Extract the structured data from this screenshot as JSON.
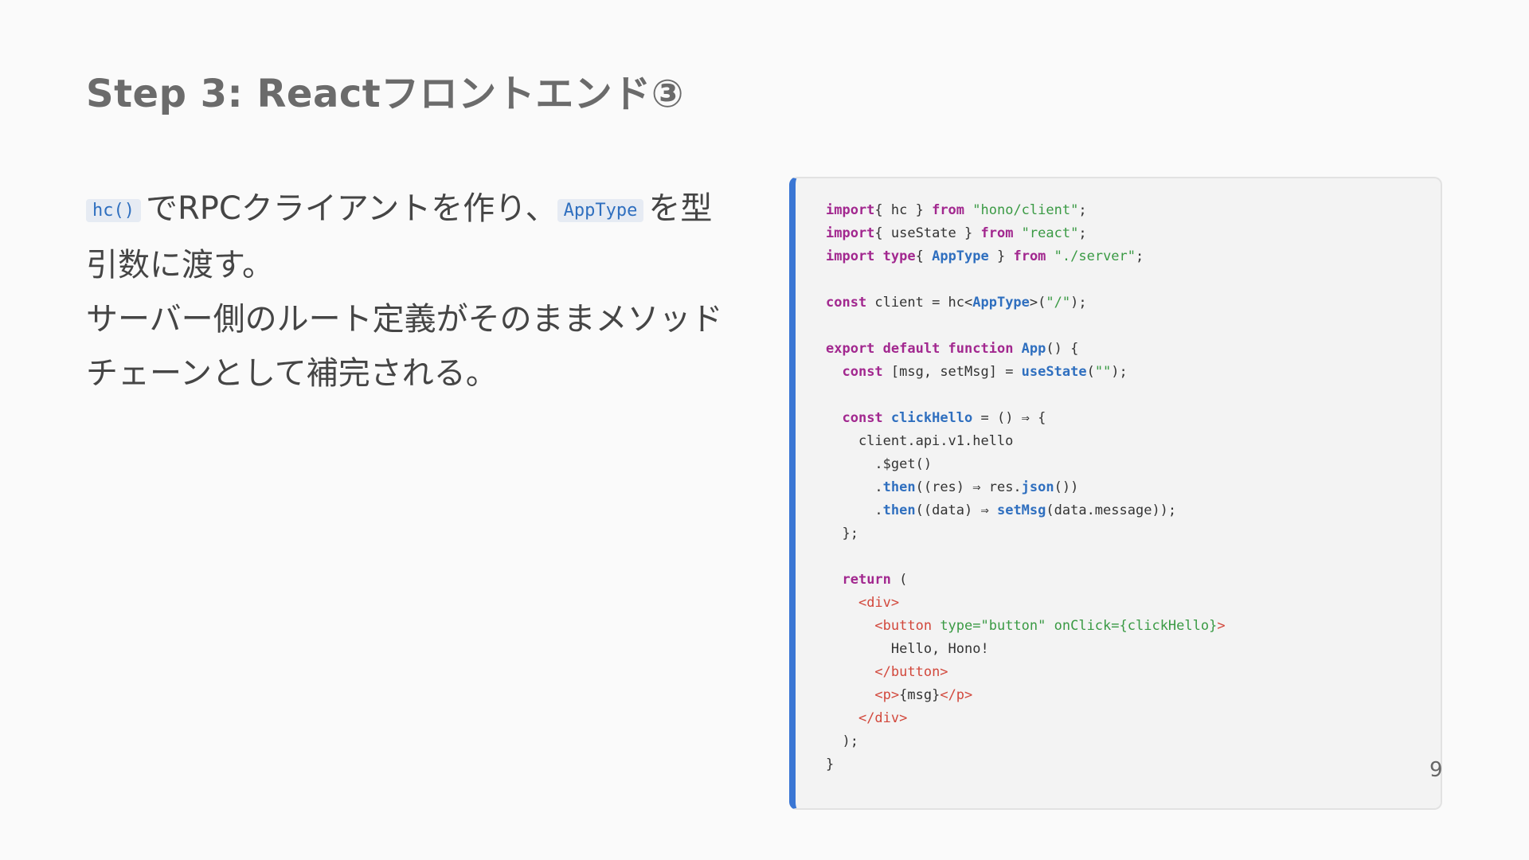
{
  "slide": {
    "title": "Step 3: Reactフロントエンド③",
    "body": {
      "code1": "hc()",
      "text1": "でRPCクライアントを作り、",
      "code2": "AppType",
      "text2": "を型引数に渡す。",
      "line2": "サーバー側のルート定義がそのままメソッドチェーンとして補完される。"
    },
    "page_number": "9"
  },
  "code": {
    "language": "tsx",
    "lines": [
      [
        [
          "kw",
          "import"
        ],
        [
          "",
          "{ hc } "
        ],
        [
          "kw",
          "from"
        ],
        [
          "str",
          " \"hono/client\""
        ],
        [
          "",
          ";"
        ]
      ],
      [
        [
          "kw",
          "import"
        ],
        [
          "",
          "{ useState } "
        ],
        [
          "kw",
          "from"
        ],
        [
          "str",
          " \"react\""
        ],
        [
          "",
          ";"
        ]
      ],
      [
        [
          "kw",
          "import"
        ],
        [
          "",
          ""
        ],
        [
          "kw",
          " type"
        ],
        [
          "",
          "{ "
        ],
        [
          "ty",
          "AppType"
        ],
        [
          "",
          " } "
        ],
        [
          "kw",
          "from"
        ],
        [
          "str",
          " \"./server\""
        ],
        [
          "",
          ";"
        ]
      ],
      [],
      [
        [
          "kw",
          "const"
        ],
        [
          "",
          " client = hc<"
        ],
        [
          "ty",
          "AppType"
        ],
        [
          "",
          ">("
        ],
        [
          "str",
          "\"/\""
        ],
        [
          "",
          ");"
        ]
      ],
      [],
      [
        [
          "kw",
          "export"
        ],
        [
          "",
          ""
        ],
        [
          "kw",
          " default"
        ],
        [
          "",
          ""
        ],
        [
          "kw",
          " function"
        ],
        [
          "fn",
          " App"
        ],
        [
          "",
          "() {"
        ]
      ],
      [
        [
          "",
          "  "
        ],
        [
          "kw",
          "const"
        ],
        [
          "",
          " [msg, setMsg] = "
        ],
        [
          "fn",
          "useState"
        ],
        [
          "",
          "("
        ],
        [
          "str",
          "\"\""
        ],
        [
          "",
          ");"
        ]
      ],
      [],
      [
        [
          "",
          "  "
        ],
        [
          "kw",
          "const"
        ],
        [
          "fn",
          " clickHello"
        ],
        [
          "",
          " = () ⇒ {"
        ]
      ],
      [
        [
          "",
          "    client.api.v1.hello"
        ]
      ],
      [
        [
          "",
          "      .$get()"
        ]
      ],
      [
        [
          "",
          "      ."
        ],
        [
          "fn",
          "then"
        ],
        [
          "",
          "((res) ⇒ res."
        ],
        [
          "fn",
          "json"
        ],
        [
          "",
          "())"
        ]
      ],
      [
        [
          "",
          "      ."
        ],
        [
          "fn",
          "then"
        ],
        [
          "",
          "((data) ⇒ "
        ],
        [
          "fn",
          "setMsg"
        ],
        [
          "",
          "(data.message));"
        ]
      ],
      [
        [
          "",
          "  };"
        ]
      ],
      [],
      [
        [
          "",
          "  "
        ],
        [
          "kw",
          "return"
        ],
        [
          "",
          " ("
        ]
      ],
      [
        [
          "",
          "    "
        ],
        [
          "tag",
          "<div>"
        ]
      ],
      [
        [
          "",
          "      "
        ],
        [
          "tag",
          "<button"
        ],
        [
          "attr",
          " type="
        ],
        [
          "str",
          "\"button\""
        ],
        [
          "attr",
          " onClick="
        ],
        [
          "str",
          "{clickHello}"
        ],
        [
          "tag",
          ">"
        ]
      ],
      [
        [
          "",
          "        Hello, Hono!"
        ]
      ],
      [
        [
          "",
          "      "
        ],
        [
          "tag",
          "</button>"
        ]
      ],
      [
        [
          "",
          "      "
        ],
        [
          "tag",
          "<p>"
        ],
        [
          "",
          "{msg}"
        ],
        [
          "tag",
          "</p>"
        ]
      ],
      [
        [
          "",
          "    "
        ],
        [
          "tag",
          "</div>"
        ]
      ],
      [
        [
          "",
          "  );"
        ]
      ],
      [
        [
          "",
          "}"
        ]
      ]
    ]
  }
}
